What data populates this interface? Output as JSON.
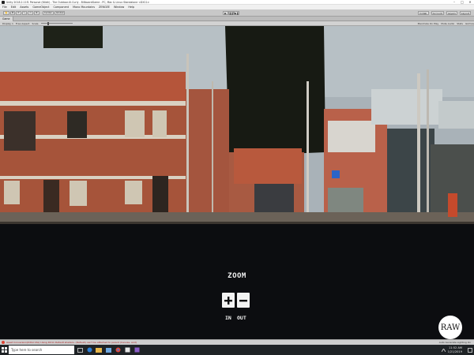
{
  "window": {
    "title": "Unity 2018.2.11f1 Personal (64bit) - The Outdoor.UI.Curly - BillboardGame - PC, Mac & Linux Standalone <DX11>",
    "controls": [
      "–",
      "□",
      "✕"
    ]
  },
  "menu": [
    "File",
    "Edit",
    "Assets",
    "GameObject",
    "Component",
    "Mono Mountains",
    "ZENGEE",
    "Window",
    "Help"
  ],
  "toolbar": {
    "tools": [
      "✋",
      "✥",
      "⟳",
      "⤡",
      "▭",
      "⚙"
    ],
    "pivot_label": "Center",
    "space_label": "Global",
    "play_controls": [
      "▶",
      "❚❚",
      "▶❚"
    ],
    "collab_label": "Collab",
    "account_label": "Account",
    "layers_label": "Layers",
    "layout_label": "Layout"
  },
  "scene_tab": {
    "label": "Game"
  },
  "scene_toolbar": {
    "display": "Display 1",
    "aspect": "Free Aspect",
    "scale_label": "Scale",
    "options": [
      "Maximize On Play",
      "Mute Audio",
      "Stats",
      "Gizmos"
    ]
  },
  "game_ui": {
    "zoom_title": "ZOOM",
    "zoom_in_label": "IN",
    "zoom_out_label": "OUT",
    "logo_text": "RAW"
  },
  "console": {
    "message": "Asset Conversion(DXGI 16x) Using DX11 Default shaders. (Default) can't be attached to parent (Canvas, and)",
    "right_text": "Auto Generate Lighting On"
  },
  "taskbar": {
    "search_placeholder": "Type here to search",
    "time": "11:52 AM",
    "date": "1/21/2019"
  }
}
